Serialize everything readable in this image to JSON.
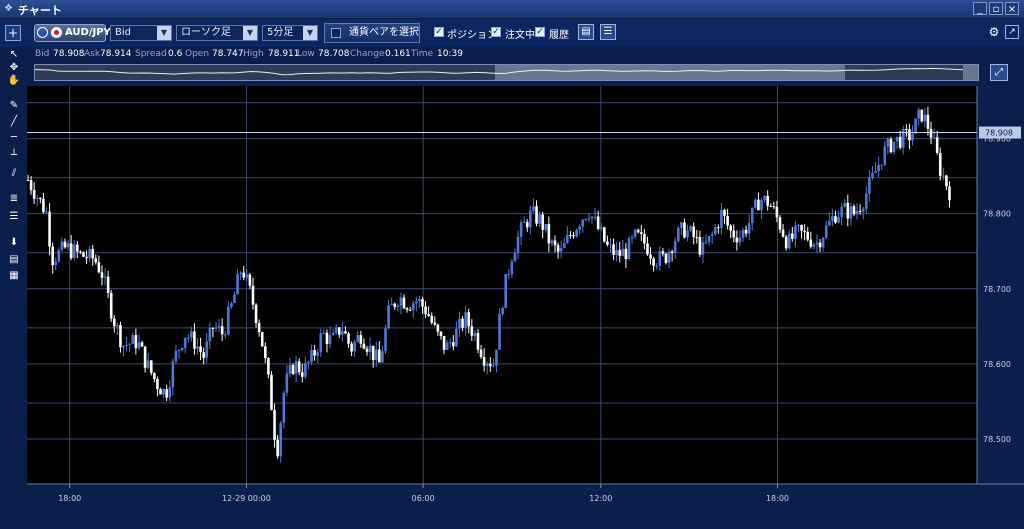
{
  "window": {
    "title": "チャート",
    "buttons": [
      "_",
      "▫",
      "×"
    ]
  },
  "toolbar": {
    "add": "+",
    "pair": "AUD/JPY",
    "price_type": "Bid",
    "chart_type": "ローソク足",
    "timeframe": "5分足",
    "select_pair": "通貨ペアを選択",
    "checks": [
      {
        "label": "ポジション",
        "checked": true
      },
      {
        "label": "注文中",
        "checked": true
      },
      {
        "label": "履歴",
        "checked": true
      }
    ]
  },
  "quote": [
    {
      "label": "Bid",
      "value": "78.908"
    },
    {
      "label": "Ask",
      "value": "78.914"
    },
    {
      "label": "Spread",
      "value": "0.6"
    },
    {
      "label": "Open",
      "value": "78.747"
    },
    {
      "label": "High",
      "value": "78.911"
    },
    {
      "label": "Low",
      "value": "78.708"
    },
    {
      "label": "Change",
      "value": "0.161"
    },
    {
      "label": "Time",
      "value": "10:39"
    }
  ],
  "colors": {
    "up": "#4f78d9",
    "down": "#ffffff",
    "background": "#000000",
    "grid": "#3a4a73",
    "current_price_bg": "#b9c9ea"
  },
  "chart_data": {
    "type": "candlestick",
    "title": "",
    "xlabel": "",
    "ylabel": "",
    "ylim": [
      78.44,
      78.97
    ],
    "y_ticks": [
      "78.500",
      "78.600",
      "78.700",
      "78.800",
      "78.900"
    ],
    "x_ticks": [
      "18:00",
      "12-29 00:00",
      "06:00",
      "12:00",
      "18:00"
    ],
    "current_price": "78.908",
    "grid": true,
    "close_path": [
      [
        0,
        78.845
      ],
      [
        0.02,
        78.8
      ],
      [
        0.025,
        78.74
      ],
      [
        0.04,
        78.755
      ],
      [
        0.055,
        78.745
      ],
      [
        0.07,
        78.74
      ],
      [
        0.078,
        78.72
      ],
      [
        0.09,
        78.66
      ],
      [
        0.1,
        78.625
      ],
      [
        0.115,
        78.63
      ],
      [
        0.125,
        78.6
      ],
      [
        0.135,
        78.575
      ],
      [
        0.145,
        78.56
      ],
      [
        0.155,
        78.61
      ],
      [
        0.165,
        78.64
      ],
      [
        0.175,
        78.63
      ],
      [
        0.185,
        78.61
      ],
      [
        0.195,
        78.65
      ],
      [
        0.205,
        78.64
      ],
      [
        0.215,
        78.68
      ],
      [
        0.225,
        78.73
      ],
      [
        0.235,
        78.69
      ],
      [
        0.245,
        78.64
      ],
      [
        0.255,
        78.56
      ],
      [
        0.262,
        78.48
      ],
      [
        0.27,
        78.57
      ],
      [
        0.28,
        78.6
      ],
      [
        0.29,
        78.59
      ],
      [
        0.3,
        78.61
      ],
      [
        0.31,
        78.64
      ],
      [
        0.32,
        78.63
      ],
      [
        0.33,
        78.65
      ],
      [
        0.34,
        78.62
      ],
      [
        0.35,
        78.64
      ],
      [
        0.36,
        78.62
      ],
      [
        0.37,
        78.6
      ],
      [
        0.38,
        78.67
      ],
      [
        0.39,
        78.69
      ],
      [
        0.4,
        78.68
      ],
      [
        0.41,
        78.685
      ],
      [
        0.42,
        78.67
      ],
      [
        0.43,
        78.64
      ],
      [
        0.44,
        78.62
      ],
      [
        0.45,
        78.64
      ],
      [
        0.46,
        78.66
      ],
      [
        0.47,
        78.64
      ],
      [
        0.48,
        78.61
      ],
      [
        0.49,
        78.6
      ],
      [
        0.5,
        78.69
      ],
      [
        0.51,
        78.75
      ],
      [
        0.52,
        78.78
      ],
      [
        0.53,
        78.8
      ],
      [
        0.54,
        78.79
      ],
      [
        0.55,
        78.76
      ],
      [
        0.56,
        78.745
      ],
      [
        0.57,
        78.77
      ],
      [
        0.58,
        78.79
      ],
      [
        0.59,
        78.805
      ],
      [
        0.6,
        78.78
      ],
      [
        0.61,
        78.755
      ],
      [
        0.62,
        78.745
      ],
      [
        0.63,
        78.75
      ],
      [
        0.64,
        78.77
      ],
      [
        0.65,
        78.76
      ],
      [
        0.66,
        78.74
      ],
      [
        0.67,
        78.74
      ],
      [
        0.68,
        78.765
      ],
      [
        0.69,
        78.78
      ],
      [
        0.7,
        78.77
      ],
      [
        0.71,
        78.75
      ],
      [
        0.72,
        78.77
      ],
      [
        0.73,
        78.8
      ],
      [
        0.74,
        78.775
      ],
      [
        0.75,
        78.77
      ],
      [
        0.76,
        78.79
      ],
      [
        0.77,
        78.82
      ],
      [
        0.78,
        78.815
      ],
      [
        0.79,
        78.79
      ],
      [
        0.8,
        78.76
      ],
      [
        0.81,
        78.775
      ],
      [
        0.82,
        78.77
      ],
      [
        0.83,
        78.76
      ],
      [
        0.84,
        78.78
      ],
      [
        0.85,
        78.8
      ],
      [
        0.86,
        78.805
      ],
      [
        0.87,
        78.8
      ],
      [
        0.88,
        78.82
      ],
      [
        0.89,
        78.85
      ],
      [
        0.9,
        78.88
      ],
      [
        0.91,
        78.895
      ],
      [
        0.92,
        78.9
      ],
      [
        0.93,
        78.905
      ],
      [
        0.94,
        78.935
      ],
      [
        0.95,
        78.91
      ],
      [
        0.96,
        78.86
      ],
      [
        0.97,
        78.83
      ]
    ]
  }
}
